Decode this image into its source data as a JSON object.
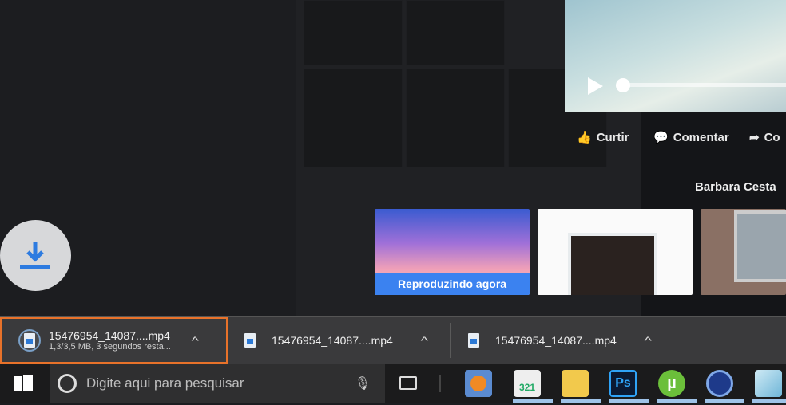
{
  "video": {
    "actions": {
      "like": "Curtir",
      "comment": "Comentar",
      "share": "Co"
    }
  },
  "profile_name": "Barbara Cesta",
  "cards": [
    {
      "caption": "Reproduzindo agora"
    }
  ],
  "downloads": [
    {
      "filename": "15476954_14087....mp4",
      "status": "1,3/3,5 MB, 3 segundos resta...",
      "active": true
    },
    {
      "filename": "15476954_14087....mp4"
    },
    {
      "filename": "15476954_14087....mp4"
    }
  ],
  "taskbar": {
    "search_placeholder": "Digite aqui para pesquisar",
    "clapper_text": "321",
    "ps_text": "Ps"
  },
  "colors": {
    "highlight": "#e8722a",
    "accent": "#3b82f0"
  }
}
